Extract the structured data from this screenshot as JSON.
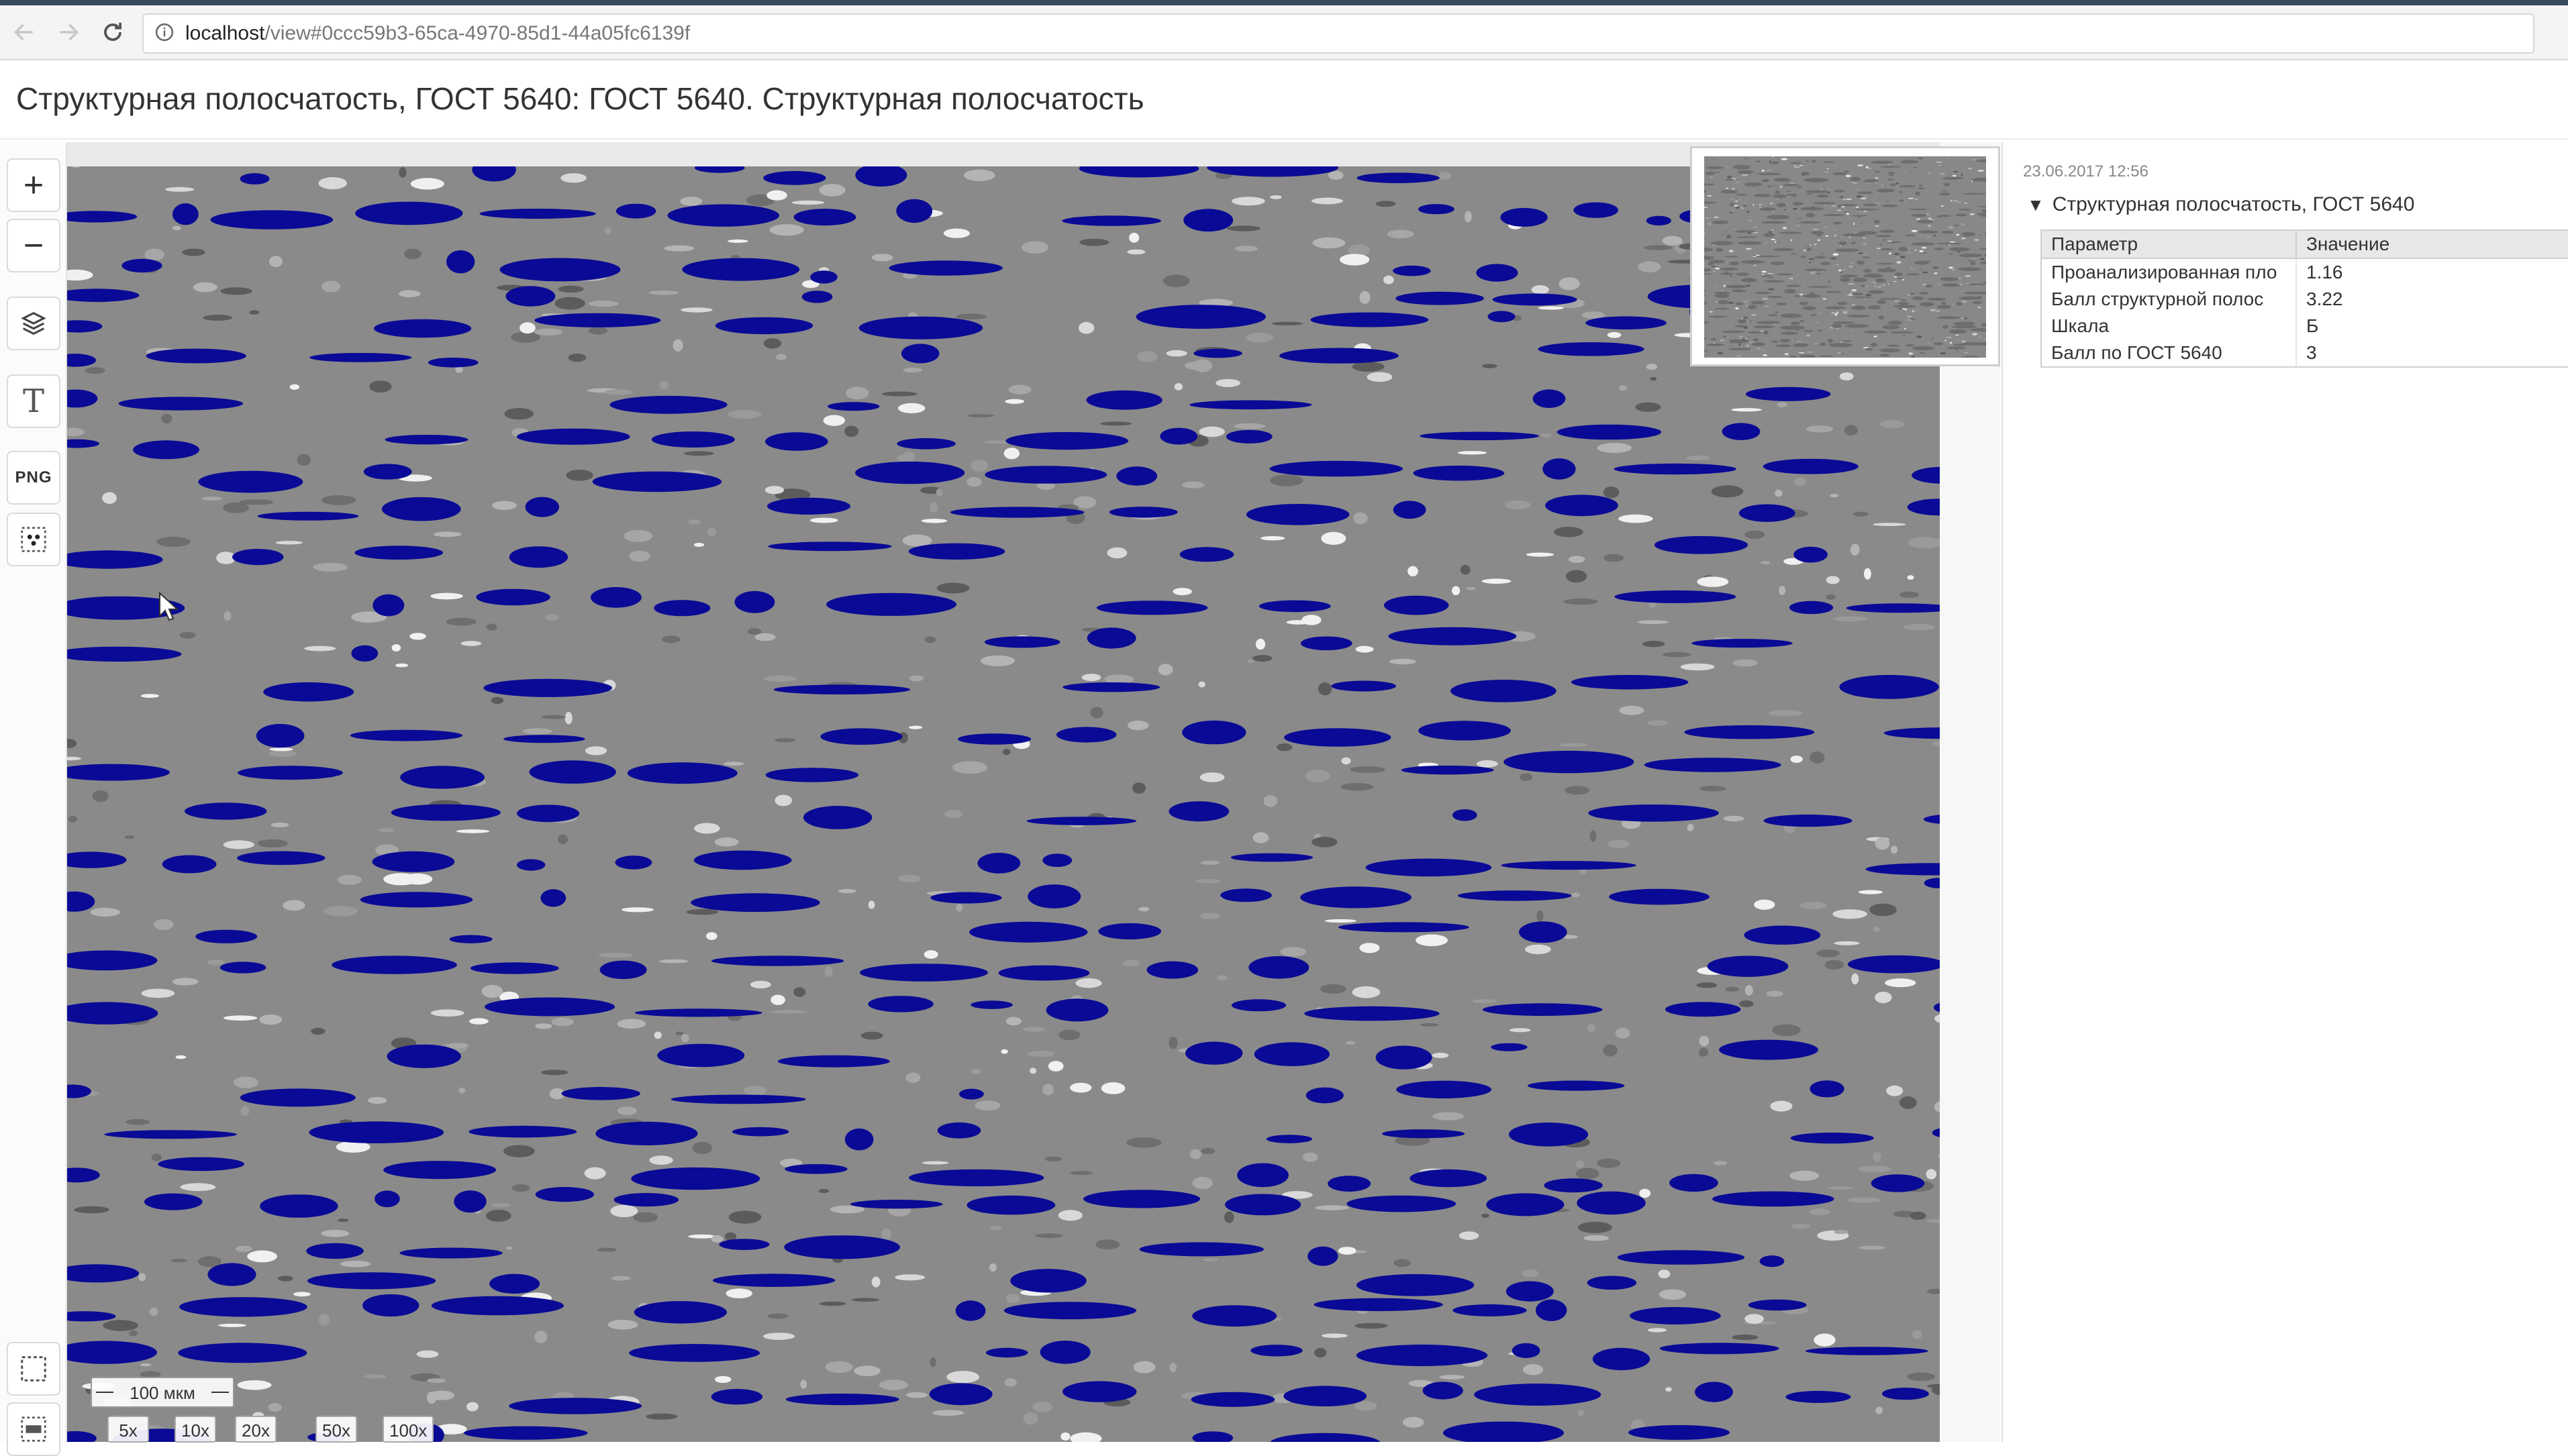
{
  "browser": {
    "url_host": "localhost",
    "url_rest": "/view#0ccc59b3-65ca-4970-85d1-44a05fc6139f"
  },
  "page": {
    "title": "Структурная полосчатость, ГОСТ 5640: ГОСТ 5640. Структурная полосчатость"
  },
  "toolbar": {
    "zoom_in_label": "+",
    "zoom_out_label": "−",
    "text_label": "T",
    "png_label": "PNG"
  },
  "viewer": {
    "scale_label": "100 мкм",
    "zoom_levels": [
      "5x",
      "10x",
      "20x",
      "50x",
      "100x"
    ],
    "overlay_color": "#0a0a96",
    "base_color": "#8a8a8a"
  },
  "panel": {
    "timestamp": "23.06.2017 12:56",
    "tree_title": "Структурная полосчатость, ГОСТ 5640",
    "columns": [
      "Параметр",
      "Значение"
    ],
    "rows": [
      {
        "param": "Проанализированная пло",
        "value": "1.16"
      },
      {
        "param": "Балл структурной полос",
        "value": "3.22"
      },
      {
        "param": "Шкала",
        "value": "Б"
      },
      {
        "param": "Балл по ГОСТ 5640",
        "value": "3"
      }
    ]
  }
}
